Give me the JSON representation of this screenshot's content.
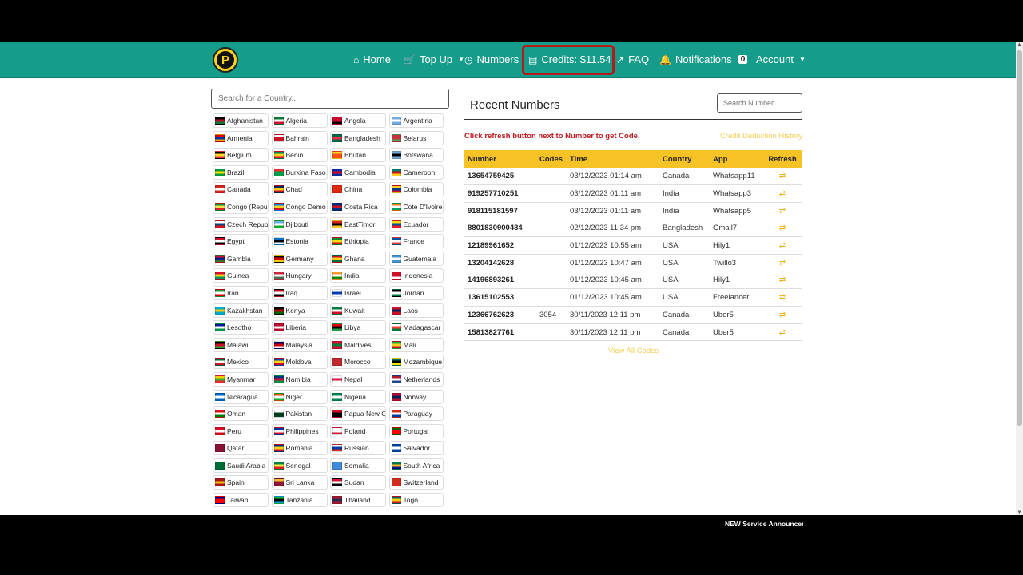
{
  "nav": {
    "logo_letter": "P",
    "home": "Home",
    "topup": "Top Up",
    "numbers": "Numbers",
    "credits": "Credits: $11.54",
    "faq": "FAQ",
    "notifications": "Notifications",
    "notifications_count": "0",
    "account": "Account"
  },
  "countries": {
    "search_placeholder": "Search for a Country...",
    "items": [
      {
        "name": "Afghanistan",
        "flag": [
          "#000000",
          "#b8102b",
          "#0a7a35"
        ]
      },
      {
        "name": "Algeria",
        "flag": [
          "#0a7a35",
          "#ffffff",
          "#d21034"
        ]
      },
      {
        "name": "Angola",
        "flag": [
          "#cc092f",
          "#cc092f",
          "#000000"
        ]
      },
      {
        "name": "Argentina",
        "flag": [
          "#74acdf",
          "#ffffff",
          "#74acdf"
        ]
      },
      {
        "name": "Armenia",
        "flag": [
          "#d90012",
          "#0033a0",
          "#f2a800"
        ]
      },
      {
        "name": "Bahrain",
        "flag": [
          "#ffffff",
          "#ce1126",
          "#ce1126"
        ]
      },
      {
        "name": "Bangladesh",
        "flag": [
          "#006a4e",
          "#f42a41",
          "#006a4e"
        ]
      },
      {
        "name": "Belarus",
        "flag": [
          "#c8313e",
          "#c8313e",
          "#4aa657"
        ]
      },
      {
        "name": "Belgium",
        "flag": [
          "#000000",
          "#fdda24",
          "#ef3340"
        ]
      },
      {
        "name": "Benin",
        "flag": [
          "#008751",
          "#fcd116",
          "#e8112d"
        ]
      },
      {
        "name": "Bhutan",
        "flag": [
          "#ffd520",
          "#ff4e12",
          "#ff4e12"
        ]
      },
      {
        "name": "Botswana",
        "flag": [
          "#75aadb",
          "#000000",
          "#75aadb"
        ]
      },
      {
        "name": "Brazil",
        "flag": [
          "#009c3b",
          "#ffdf00",
          "#009c3b"
        ]
      },
      {
        "name": "Burkina Faso",
        "flag": [
          "#ef2b2d",
          "#009e49",
          "#009e49"
        ]
      },
      {
        "name": "Cambodia",
        "flag": [
          "#032ea1",
          "#e00025",
          "#032ea1"
        ]
      },
      {
        "name": "Cameroon",
        "flag": [
          "#007a5e",
          "#ce1126",
          "#fcd116"
        ]
      },
      {
        "name": "Canada",
        "flag": [
          "#d52b1e",
          "#ffffff",
          "#d52b1e"
        ]
      },
      {
        "name": "Chad",
        "flag": [
          "#002664",
          "#fecb00",
          "#c60c30"
        ]
      },
      {
        "name": "China",
        "flag": [
          "#de2910",
          "#de2910",
          "#de2910"
        ]
      },
      {
        "name": "Colombia",
        "flag": [
          "#fcd116",
          "#003893",
          "#ce1126"
        ]
      },
      {
        "name": "Congo (Repu",
        "flag": [
          "#009543",
          "#fbde4a",
          "#dc241f"
        ]
      },
      {
        "name": "Congo Demo",
        "flag": [
          "#007fff",
          "#f7d618",
          "#ce1021"
        ]
      },
      {
        "name": "Costa Rica",
        "flag": [
          "#002b7f",
          "#ce1126",
          "#002b7f"
        ]
      },
      {
        "name": "Cote D'Ivoire",
        "flag": [
          "#f77f00",
          "#ffffff",
          "#009e60"
        ]
      },
      {
        "name": "Czech Republ",
        "flag": [
          "#ffffff",
          "#11457e",
          "#d7141a"
        ]
      },
      {
        "name": "Djibouti",
        "flag": [
          "#6ab2e7",
          "#ffffff",
          "#12ad2b"
        ]
      },
      {
        "name": "EastTimor",
        "flag": [
          "#dc241f",
          "#000000",
          "#ffc726"
        ]
      },
      {
        "name": "Ecuador",
        "flag": [
          "#ffdd00",
          "#034ea2",
          "#ed1c24"
        ]
      },
      {
        "name": "Egypt",
        "flag": [
          "#ce1126",
          "#ffffff",
          "#000000"
        ]
      },
      {
        "name": "Estonia",
        "flag": [
          "#0072ce",
          "#000000",
          "#ffffff"
        ]
      },
      {
        "name": "Ethiopia",
        "flag": [
          "#078930",
          "#fcdd09",
          "#da121a"
        ]
      },
      {
        "name": "France",
        "flag": [
          "#0055a4",
          "#ffffff",
          "#ef4135"
        ]
      },
      {
        "name": "Gambia",
        "flag": [
          "#ce1126",
          "#0c1c8c",
          "#3a7728"
        ]
      },
      {
        "name": "Germany",
        "flag": [
          "#000000",
          "#dd0000",
          "#ffce00"
        ]
      },
      {
        "name": "Ghana",
        "flag": [
          "#ce1126",
          "#fcd116",
          "#006b3f"
        ]
      },
      {
        "name": "Guatemala",
        "flag": [
          "#4997d0",
          "#ffffff",
          "#4997d0"
        ]
      },
      {
        "name": "Guinea",
        "flag": [
          "#ce1126",
          "#fcd116",
          "#009460"
        ]
      },
      {
        "name": "Hungary",
        "flag": [
          "#ce2939",
          "#ffffff",
          "#477050"
        ]
      },
      {
        "name": "India",
        "flag": [
          "#ff9933",
          "#ffffff",
          "#138808"
        ]
      },
      {
        "name": "Indonesia",
        "flag": [
          "#ce1126",
          "#ce1126",
          "#ffffff"
        ]
      },
      {
        "name": "Iran",
        "flag": [
          "#239f40",
          "#ffffff",
          "#da0000"
        ]
      },
      {
        "name": "Iraq",
        "flag": [
          "#ce1126",
          "#ffffff",
          "#000000"
        ]
      },
      {
        "name": "Israel",
        "flag": [
          "#ffffff",
          "#0038b8",
          "#ffffff"
        ]
      },
      {
        "name": "Jordan",
        "flag": [
          "#000000",
          "#ffffff",
          "#007a3d"
        ]
      },
      {
        "name": "Kazakhstan",
        "flag": [
          "#00afca",
          "#fec50c",
          "#00afca"
        ]
      },
      {
        "name": "Kenya",
        "flag": [
          "#000000",
          "#bb0000",
          "#006600"
        ]
      },
      {
        "name": "Kuwait",
        "flag": [
          "#007a3d",
          "#ffffff",
          "#ce1126"
        ]
      },
      {
        "name": "Laos",
        "flag": [
          "#ce1126",
          "#002868",
          "#ce1126"
        ]
      },
      {
        "name": "Lesotho",
        "flag": [
          "#00209f",
          "#ffffff",
          "#009543"
        ]
      },
      {
        "name": "Liberia",
        "flag": [
          "#bf0a30",
          "#ffffff",
          "#bf0a30"
        ]
      },
      {
        "name": "Libya",
        "flag": [
          "#e70013",
          "#000000",
          "#239e46"
        ]
      },
      {
        "name": "Madagascar",
        "flag": [
          "#ffffff",
          "#fc3d32",
          "#007e3a"
        ]
      },
      {
        "name": "Malawi",
        "flag": [
          "#000000",
          "#ce1126",
          "#339e35"
        ]
      },
      {
        "name": "Malaysia",
        "flag": [
          "#010066",
          "#cc0001",
          "#ffffff"
        ]
      },
      {
        "name": "Maldives",
        "flag": [
          "#d21034",
          "#007e3a",
          "#d21034"
        ]
      },
      {
        "name": "Mali",
        "flag": [
          "#14b53a",
          "#fcd116",
          "#ce1126"
        ]
      },
      {
        "name": "Mexico",
        "flag": [
          "#006847",
          "#ffffff",
          "#ce1126"
        ]
      },
      {
        "name": "Moldova",
        "flag": [
          "#0046ae",
          "#ffd200",
          "#cc092f"
        ]
      },
      {
        "name": "Morocco",
        "flag": [
          "#c1272d",
          "#c1272d",
          "#c1272d"
        ]
      },
      {
        "name": "Mozambique",
        "flag": [
          "#007168",
          "#000000",
          "#fce100"
        ]
      },
      {
        "name": "Myanmar",
        "flag": [
          "#fecb00",
          "#34b233",
          "#ea2839"
        ]
      },
      {
        "name": "Namibia",
        "flag": [
          "#003580",
          "#d21034",
          "#009543"
        ]
      },
      {
        "name": "Nepal",
        "flag": [
          "#ffffff",
          "#dc143c",
          "#ffffff"
        ]
      },
      {
        "name": "Netherlands",
        "flag": [
          "#ae1c28",
          "#ffffff",
          "#21468b"
        ]
      },
      {
        "name": "Nicaragua",
        "flag": [
          "#0067c6",
          "#ffffff",
          "#0067c6"
        ]
      },
      {
        "name": "Niger",
        "flag": [
          "#e05206",
          "#ffffff",
          "#0db02b"
        ]
      },
      {
        "name": "Nigeria",
        "flag": [
          "#008751",
          "#ffffff",
          "#008751"
        ]
      },
      {
        "name": "Norway",
        "flag": [
          "#ba0c2f",
          "#00205b",
          "#ba0c2f"
        ]
      },
      {
        "name": "Oman",
        "flag": [
          "#db161b",
          "#ffffff",
          "#008000"
        ]
      },
      {
        "name": "Pakistan",
        "flag": [
          "#ffffff",
          "#01411c",
          "#01411c"
        ]
      },
      {
        "name": "Papua New G",
        "flag": [
          "#ce1126",
          "#000000",
          "#000000"
        ]
      },
      {
        "name": "Paraguay",
        "flag": [
          "#d52b1e",
          "#ffffff",
          "#0038a8"
        ]
      },
      {
        "name": "Peru",
        "flag": [
          "#d91023",
          "#ffffff",
          "#d91023"
        ]
      },
      {
        "name": "Philippines",
        "flag": [
          "#0038a8",
          "#ffffff",
          "#ce1126"
        ]
      },
      {
        "name": "Poland",
        "flag": [
          "#ffffff",
          "#ffffff",
          "#dc143c"
        ]
      },
      {
        "name": "Portugal",
        "flag": [
          "#006600",
          "#ff0000",
          "#ff0000"
        ]
      },
      {
        "name": "Qatar",
        "flag": [
          "#8a1538",
          "#8a1538",
          "#8a1538"
        ]
      },
      {
        "name": "Romania",
        "flag": [
          "#002b7f",
          "#fcd116",
          "#ce1126"
        ]
      },
      {
        "name": "Russian",
        "flag": [
          "#ffffff",
          "#0039a6",
          "#d52b1e"
        ]
      },
      {
        "name": "Salvador",
        "flag": [
          "#0047ab",
          "#ffffff",
          "#0047ab"
        ]
      },
      {
        "name": "Saudi Arabia",
        "flag": [
          "#006c35",
          "#006c35",
          "#006c35"
        ]
      },
      {
        "name": "Senegal",
        "flag": [
          "#00853f",
          "#fdef42",
          "#e31b23"
        ]
      },
      {
        "name": "Somalia",
        "flag": [
          "#4189dd",
          "#4189dd",
          "#4189dd"
        ]
      },
      {
        "name": "South Africa",
        "flag": [
          "#007749",
          "#ffb81c",
          "#001489"
        ]
      },
      {
        "name": "Spain",
        "flag": [
          "#aa151b",
          "#f1bf00",
          "#aa151b"
        ]
      },
      {
        "name": "Sri Lanka",
        "flag": [
          "#ffbe29",
          "#8d153a",
          "#8d153a"
        ]
      },
      {
        "name": "Sudan",
        "flag": [
          "#d21034",
          "#ffffff",
          "#000000"
        ]
      },
      {
        "name": "Switzerland",
        "flag": [
          "#d52b1e",
          "#d52b1e",
          "#d52b1e"
        ]
      },
      {
        "name": "Taiwan",
        "flag": [
          "#000095",
          "#fe0000",
          "#fe0000"
        ]
      },
      {
        "name": "Tanzania",
        "flag": [
          "#1eb53a",
          "#000000",
          "#00a3dd"
        ]
      },
      {
        "name": "Thailand",
        "flag": [
          "#a51931",
          "#2d2a4a",
          "#a51931"
        ]
      },
      {
        "name": "Togo",
        "flag": [
          "#006a4e",
          "#ffce00",
          "#d21034"
        ]
      }
    ]
  },
  "recent": {
    "title": "Recent Numbers",
    "search_placeholder": "Search Number...",
    "refresh_msg": "Click refresh button next to Number to get Code.",
    "deduction_link": "Credit Deduction History",
    "view_all": "View All Codes",
    "headers": {
      "number": "Number",
      "codes": "Codes",
      "time": "Time",
      "country": "Country",
      "app": "App",
      "refresh": "Refresh"
    },
    "rows": [
      {
        "number": "13654759425",
        "codes": "",
        "time": "03/12/2023 01:14 am",
        "country": "Canada",
        "app": "Whatsapp11"
      },
      {
        "number": "919257710251",
        "codes": "",
        "time": "03/12/2023 01:11 am",
        "country": "India",
        "app": "Whatsapp3"
      },
      {
        "number": "918115181597",
        "codes": "",
        "time": "03/12/2023 01:11 am",
        "country": "India",
        "app": "Whatsapp5"
      },
      {
        "number": "8801830900484",
        "codes": "",
        "time": "02/12/2023 11:34 pm",
        "country": "Bangladesh",
        "app": "Gmail7"
      },
      {
        "number": "12189961652",
        "codes": "",
        "time": "01/12/2023 10:55 am",
        "country": "USA",
        "app": "Hily1"
      },
      {
        "number": "13204142628",
        "codes": "",
        "time": "01/12/2023 10:47 am",
        "country": "USA",
        "app": "Twillo3"
      },
      {
        "number": "14196893261",
        "codes": "",
        "time": "01/12/2023 10:45 am",
        "country": "USA",
        "app": "Hily1"
      },
      {
        "number": "13615102553",
        "codes": "",
        "time": "01/12/2023 10:45 am",
        "country": "USA",
        "app": "Freelancer"
      },
      {
        "number": "12366762623",
        "codes": "3054",
        "time": "30/11/2023 12:11 pm",
        "country": "Canada",
        "app": "Uber5"
      },
      {
        "number": "15813827761",
        "codes": "",
        "time": "30/11/2023 12:11 pm",
        "country": "Canada",
        "app": "Uber5"
      }
    ]
  },
  "ticker": "NEW Service Announcement",
  "colors": {
    "navbar": "#169c8a",
    "table_header": "#f5c325",
    "alert_red": "#c0191f",
    "link_yellow": "#f2cf57",
    "credits_outline": "#b31b1b"
  }
}
